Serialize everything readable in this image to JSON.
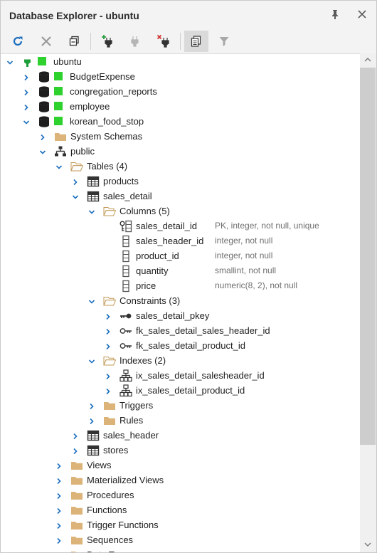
{
  "window": {
    "title": "Database Explorer - ubuntu"
  },
  "toolbar": {
    "buttons": [
      "refresh-icon",
      "disconnect-icon",
      "collapse-all-icon",
      "new-connection-icon",
      "connect-icon",
      "delete-connection-icon",
      "copy-icon",
      "filter-icon"
    ]
  },
  "tree": {
    "server": "ubuntu",
    "databases": {
      "db1": "BudgetExpense",
      "db2": "congregation_reports",
      "db3": "employee",
      "db4": "korean_food_stop"
    },
    "system_schemas": "System Schemas",
    "schema_public": "public",
    "tables_folder": "Tables (4)",
    "tables": {
      "products": "products",
      "sales_detail": "sales_detail",
      "sales_header": "sales_header",
      "stores": "stores"
    },
    "columns_folder": "Columns (5)",
    "columns": [
      {
        "name": "sales_detail_id",
        "detail": "PK, integer, not null, unique"
      },
      {
        "name": "sales_header_id",
        "detail": "integer, not null"
      },
      {
        "name": "product_id",
        "detail": "integer, not null"
      },
      {
        "name": "quantity",
        "detail": "smallint, not null"
      },
      {
        "name": "price",
        "detail": "numeric(8, 2), not null"
      }
    ],
    "constraints_folder": "Constraints (3)",
    "constraints": [
      "sales_detail_pkey",
      "fk_sales_detail_sales_header_id",
      "fk_sales_detail_product_id"
    ],
    "indexes_folder": "Indexes (2)",
    "indexes": [
      "ix_sales_detail_salesheader_id",
      "ix_sales_detail_product_id"
    ],
    "triggers": "Triggers",
    "rules": "Rules",
    "schema_folders": [
      "Views",
      "Materialized Views",
      "Procedures",
      "Functions",
      "Trigger Functions",
      "Sequences",
      "Data Types"
    ]
  },
  "colors": {
    "accent": "#1c6fbf",
    "status_ok": "#2ed12e",
    "folder": "#dcb47a"
  }
}
